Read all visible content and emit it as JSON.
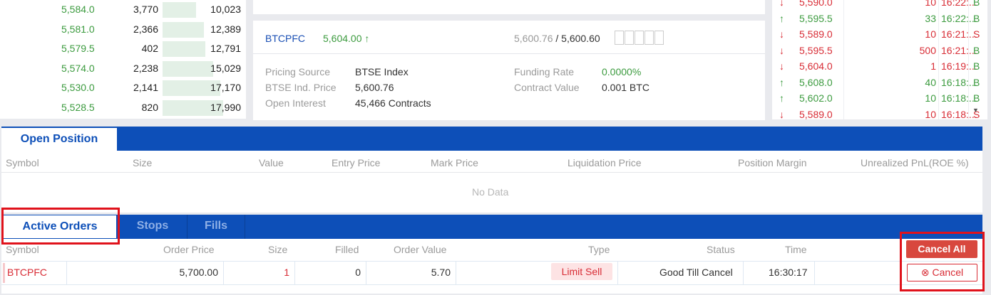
{
  "orderbook": {
    "rows": [
      {
        "price": "5,584.0",
        "size": "3,770",
        "total": "10,023",
        "depth": 0.42
      },
      {
        "price": "5,581.0",
        "size": "2,366",
        "total": "12,389",
        "depth": 0.52
      },
      {
        "price": "5,579.5",
        "size": "402",
        "total": "12,791",
        "depth": 0.54
      },
      {
        "price": "5,574.0",
        "size": "2,238",
        "total": "15,029",
        "depth": 0.63
      },
      {
        "price": "5,530.0",
        "size": "2,141",
        "total": "17,170",
        "depth": 0.72
      },
      {
        "price": "5,528.5",
        "size": "820",
        "total": "17,990",
        "depth": 0.76
      }
    ]
  },
  "ticker": {
    "symbol": "BTCPFC",
    "last_price": "5,604.00",
    "up_arrow": "↑",
    "bid": "5,600.76",
    "ask": "/ 5,600.60",
    "pricing_source_label": "Pricing Source",
    "pricing_source_value": "BTSE Index",
    "index_price_label": "BTSE Ind. Price",
    "index_price_value": "5,600.76",
    "open_interest_label": "Open Interest",
    "open_interest_value": "45,466 Contracts",
    "funding_rate_label": "Funding Rate",
    "funding_rate_value": "0.0000%",
    "contract_value_label": "Contract Value",
    "contract_value_value": "0.001 BTC"
  },
  "trades": {
    "rows": [
      {
        "dir": "down",
        "arrow": "↓",
        "price": "5,590.0",
        "size": "10",
        "time": "16:22:...",
        "side": "B"
      },
      {
        "dir": "up",
        "arrow": "↑",
        "price": "5,595.5",
        "size": "33",
        "time": "16:22:...",
        "side": "B"
      },
      {
        "dir": "down",
        "arrow": "↓",
        "price": "5,589.0",
        "size": "10",
        "time": "16:21:...",
        "side": "S"
      },
      {
        "dir": "down",
        "arrow": "↓",
        "price": "5,595.5",
        "size": "500",
        "time": "16:21:...",
        "side": "B"
      },
      {
        "dir": "down",
        "arrow": "↓",
        "price": "5,604.0",
        "size": "1",
        "time": "16:19:...",
        "side": "B"
      },
      {
        "dir": "up",
        "arrow": "↑",
        "price": "5,608.0",
        "size": "40",
        "time": "16:18:...",
        "side": "B"
      },
      {
        "dir": "up",
        "arrow": "↑",
        "price": "5,602.0",
        "size": "10",
        "time": "16:18:...",
        "side": "B"
      },
      {
        "dir": "down",
        "arrow": "↓",
        "price": "5,589.0",
        "size": "10",
        "time": "16:18:...",
        "side": "S"
      }
    ],
    "scroll_arrow": "▼"
  },
  "positions": {
    "tab_label": "Open Position",
    "headers": {
      "symbol": "Symbol",
      "size": "Size",
      "value": "Value",
      "entry": "Entry Price",
      "mark": "Mark Price",
      "liq": "Liquidation Price",
      "margin": "Position Margin",
      "pnl": "Unrealized PnL(ROE %)"
    },
    "empty_text": "No Data"
  },
  "orders": {
    "tabs": [
      "Active Orders",
      "Stops",
      "Fills"
    ],
    "headers": {
      "symbol": "Symbol",
      "price": "Order Price",
      "size": "Size",
      "filled": "Filled",
      "value": "Order Value",
      "type": "Type",
      "status": "Status",
      "time": "Time"
    },
    "cancel_all_label": "Cancel All",
    "row": {
      "symbol": "BTCPFC",
      "price": "5,700.00",
      "size": "1",
      "filled": "0",
      "value": "5.70",
      "type": "Limit Sell",
      "status": "Good Till Cancel",
      "time": "16:30:17",
      "cancel_label": "Cancel",
      "cancel_icon": "⊗"
    }
  },
  "colors": {
    "brand_blue": "#0d4fb8",
    "buy_green": "#3c9b3f",
    "sell_red": "#d82c35"
  }
}
